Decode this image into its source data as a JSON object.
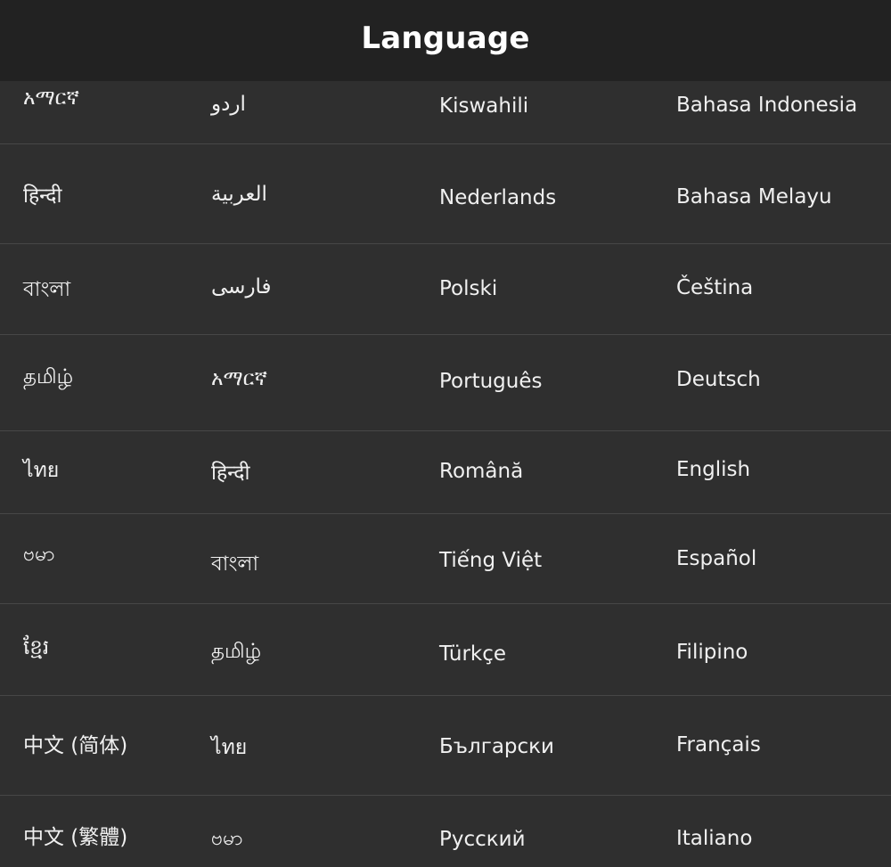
{
  "header": {
    "title": "Language"
  },
  "rows": [
    [
      "አማርኛ",
      "اردو",
      "Kiswahili",
      "Bahasa Indonesia"
    ],
    [
      "हिन्दी",
      "العربية",
      "Nederlands",
      "Bahasa Melayu"
    ],
    [
      "বাংলা",
      "فارسی",
      "Polski",
      "Čeština"
    ],
    [
      "தமிழ்",
      "አማርኛ",
      "Português",
      "Deutsch"
    ],
    [
      "ไทย",
      "हिन्दी",
      "Română",
      "English"
    ],
    [
      "ဗမာ",
      "বাংলা",
      "Tiếng Việt",
      "Español"
    ],
    [
      "ខ្មែរ",
      "தமிழ்",
      "Türkçe",
      "Filipino"
    ],
    [
      "中文 (简体)",
      "ไทย",
      "Български",
      "Français"
    ],
    [
      "中文 (繁體)",
      "ဗမာ",
      "Русский",
      "Italiano"
    ]
  ]
}
